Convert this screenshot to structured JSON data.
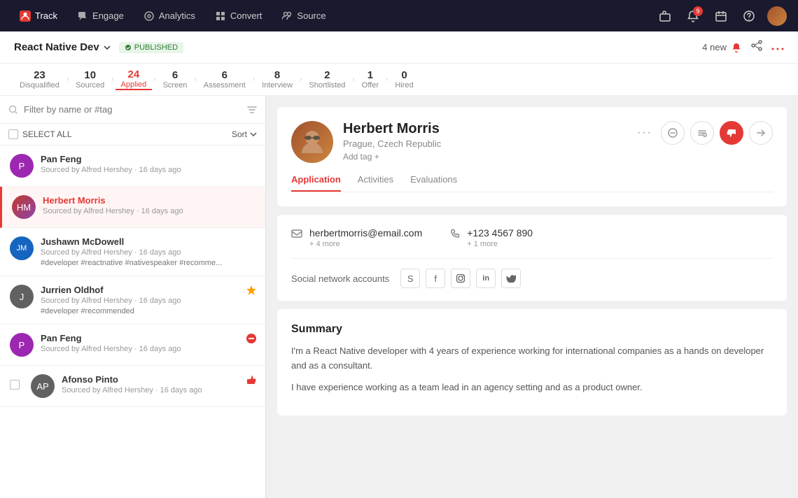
{
  "nav": {
    "items": [
      {
        "id": "track",
        "label": "Track",
        "icon": "👤",
        "active": true
      },
      {
        "id": "engage",
        "label": "Engage",
        "icon": "💬",
        "active": false
      },
      {
        "id": "analytics",
        "label": "Analytics",
        "icon": "◎",
        "active": false
      },
      {
        "id": "convert",
        "label": "Convert",
        "icon": "⊞",
        "active": false
      },
      {
        "id": "source",
        "label": "Source",
        "icon": "👥",
        "active": false
      }
    ]
  },
  "subheader": {
    "job_title": "React Native Dev",
    "published_label": "PUBLISHED",
    "new_notif": "4 new"
  },
  "stages": [
    {
      "count": "23",
      "label": "Disqualified",
      "active": false
    },
    {
      "count": "10",
      "label": "Sourced",
      "active": false
    },
    {
      "count": "24",
      "label": "Applied",
      "active": true
    },
    {
      "count": "6",
      "label": "Screen",
      "active": false
    },
    {
      "count": "6",
      "label": "Assessment",
      "active": false
    },
    {
      "count": "8",
      "label": "Interview",
      "active": false
    },
    {
      "count": "2",
      "label": "Shortlisted",
      "active": false
    },
    {
      "count": "1",
      "label": "Offer",
      "active": false
    },
    {
      "count": "0",
      "label": "Hired",
      "active": false
    }
  ],
  "search": {
    "placeholder": "Filter by name or #tag"
  },
  "select_all": "SELECT ALL",
  "sort_label": "Sort",
  "candidates": [
    {
      "id": "pan-feng-top",
      "name": "Pan Feng",
      "initials": "P",
      "meta": "Sourced by Alfred Hershey · 16 days ago",
      "tags": "",
      "active": false,
      "avatar_color": "#9c27b0"
    },
    {
      "id": "herbert-morris",
      "name": "Herbert Morris",
      "initials": "HM",
      "meta": "Sourced by Alfred Hershey · 16 days ago",
      "tags": "",
      "active": true,
      "avatar_color": "#e53935"
    },
    {
      "id": "jushawn-mcdowell",
      "name": "Jushawn McDowell",
      "initials": "JM",
      "meta": "Sourced by Alfred Hershey · 16 days ago",
      "tags": "#developer #reactnative #nativespeaker #recomme...",
      "active": false,
      "avatar_color": "#1565c0"
    },
    {
      "id": "jurrien-oldhof",
      "name": "Jurrien Oldhof",
      "initials": "J",
      "meta": "Sourced by Alfred Hershey · 16 days ago",
      "tags": "#developer #recommended",
      "active": false,
      "avatar_color": "#616161",
      "badge": "star"
    },
    {
      "id": "pan-feng",
      "name": "Pan Feng",
      "initials": "P",
      "meta": "Sourced by Alfred Hershey · 16 days ago",
      "tags": "",
      "active": false,
      "avatar_color": "#9c27b0",
      "badge": "disqualify"
    },
    {
      "id": "afonso-pinto",
      "name": "Afonso Pinto",
      "initials": "AP",
      "meta": "Sourced by Alfred Hershey · 16 days ago",
      "tags": "",
      "active": false,
      "avatar_color": "#616161",
      "badge": "like",
      "has_checkbox": true
    }
  ],
  "selected_candidate": {
    "name": "Herbert Morris",
    "location": "Prague, Czech Republic",
    "add_tag": "Add tag +",
    "email": "herbertmorris@email.com",
    "email_more": "+ 4 more",
    "phone": "+123 4567 890",
    "phone_more": "+ 1 more",
    "social_label": "Social network accounts",
    "socials": [
      "S",
      "f",
      "◎",
      "in",
      "🐦"
    ],
    "tabs": [
      {
        "label": "Application",
        "active": true
      },
      {
        "label": "Activities",
        "active": false
      },
      {
        "label": "Evaluations",
        "active": false
      }
    ],
    "summary_title": "Summary",
    "summary_paragraphs": [
      "I'm a React Native developer with 4 years of experience working for international companies as a hands on developer and as a consultant.",
      "I have experience working as a team lead in an agency setting and as a product owner."
    ]
  }
}
